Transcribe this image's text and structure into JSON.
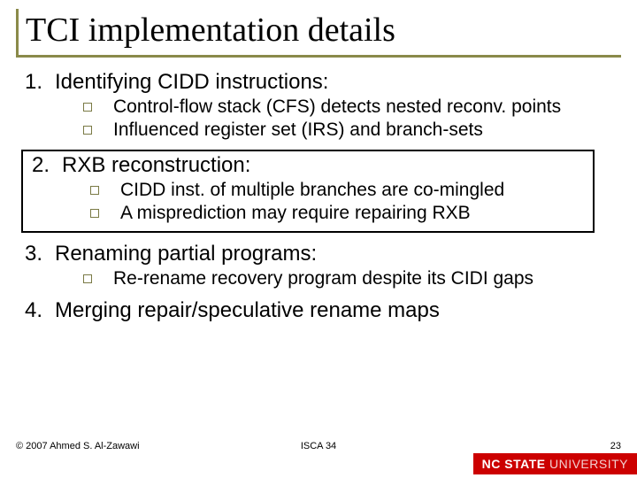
{
  "title": "TCI implementation details",
  "items": [
    {
      "num": "1.",
      "text": "Identifying CIDD instructions:",
      "subs": [
        "Control-flow stack (CFS) detects nested reconv. points",
        "Influenced register set (IRS) and branch-sets"
      ],
      "highlight": false
    },
    {
      "num": "2.",
      "text": "RXB reconstruction:",
      "subs": [
        "CIDD inst. of multiple branches are co-mingled",
        "A misprediction may require repairing RXB"
      ],
      "highlight": true
    },
    {
      "num": "3.",
      "text": "Renaming partial programs:",
      "subs": [
        "Re-rename recovery program despite its CIDI gaps"
      ],
      "highlight": false
    },
    {
      "num": "4.",
      "text": "Merging repair/speculative rename maps",
      "subs": [],
      "highlight": false
    }
  ],
  "footer": {
    "left": "© 2007 Ahmed S. Al-Zawawi",
    "mid": "ISCA 34",
    "right": "23"
  },
  "brand": {
    "a": "NC STATE",
    "b": " UNIVERSITY"
  }
}
